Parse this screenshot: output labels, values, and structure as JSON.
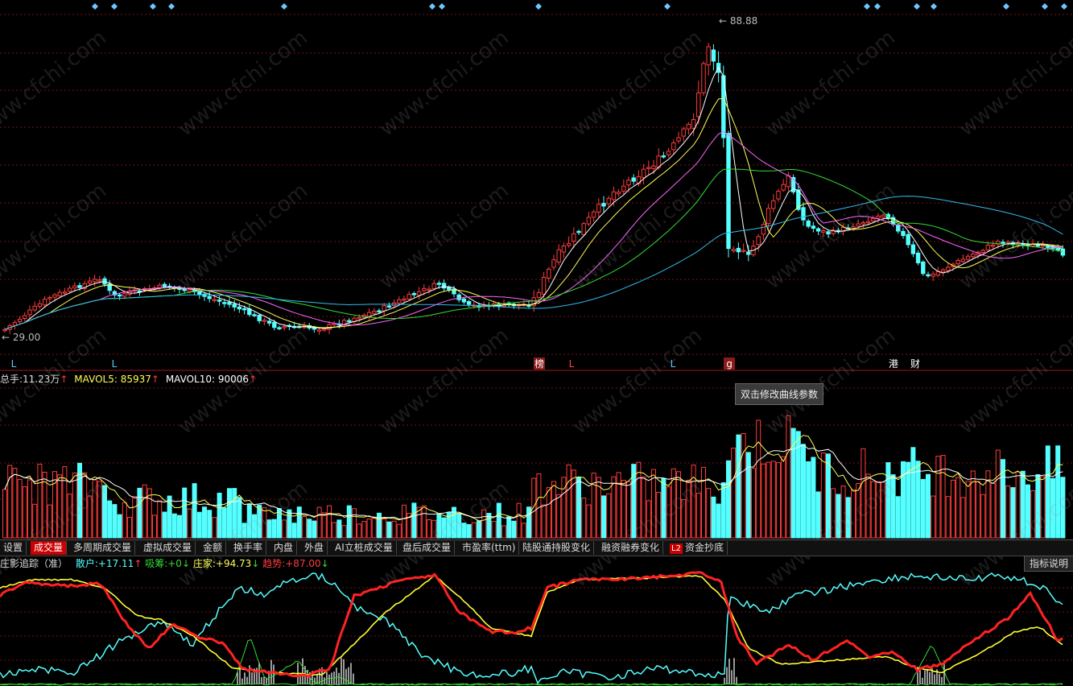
{
  "price_panel": {
    "high_label": "88.88",
    "low_label": "29.00",
    "markers": [
      {
        "text": "L",
        "color": "#55ccff"
      },
      {
        "text": "L",
        "color": "#55ccff"
      },
      {
        "text": "榜",
        "color": "#ffffff",
        "bg": "#8b1a1a"
      },
      {
        "text": "L",
        "color": "#ff4444"
      },
      {
        "text": "L",
        "color": "#55ccff"
      },
      {
        "text": "g",
        "color": "#ffffff",
        "bg": "#8b1a1a"
      },
      {
        "text": "港",
        "color": "#ffffff"
      },
      {
        "text": "财",
        "color": "#ffffff"
      }
    ]
  },
  "volume_panel": {
    "label": "总手:",
    "value": "11.23万",
    "ma5_label": "MAVOL5:",
    "ma5_value": "85937",
    "ma10_label": "MAVOL10:",
    "ma10_value": "90006",
    "arrow": "↑",
    "tooltip": "双击修改曲线参数"
  },
  "tabs": [
    "设置",
    "成交量",
    "多周期成交量",
    "虚拟成交量",
    "金额",
    "换手率",
    "内盘",
    "外盘",
    "AI立桩成交量",
    "盘后成交量",
    "市盈率(ttm)",
    "陆股通持股变化",
    "融资融券变化",
    "资金抄底"
  ],
  "tab_badge": "L2",
  "active_tab": "成交量",
  "indicator_panel": {
    "title": "庄影追踪（准）",
    "retail_label": "散户:",
    "retail_value": "+17.11",
    "absorb_label": "吸筹:",
    "absorb_value": "+0",
    "dealer_label": "庄家:",
    "dealer_value": "+94.73",
    "trend_label": "趋势:",
    "trend_value": "+87.00",
    "up": "↑",
    "down": "↓",
    "explain_button": "指标说明"
  },
  "watermark": "www.cfchi.com",
  "colors": {
    "up": "#ff3b3b",
    "down": "#54ffff",
    "ma5": "#ffffff",
    "ma10": "#ffff55",
    "ma20": "#ff66ff",
    "ma30": "#33dd33",
    "ma60": "#33bbee",
    "grid": "#7a1515"
  }
}
